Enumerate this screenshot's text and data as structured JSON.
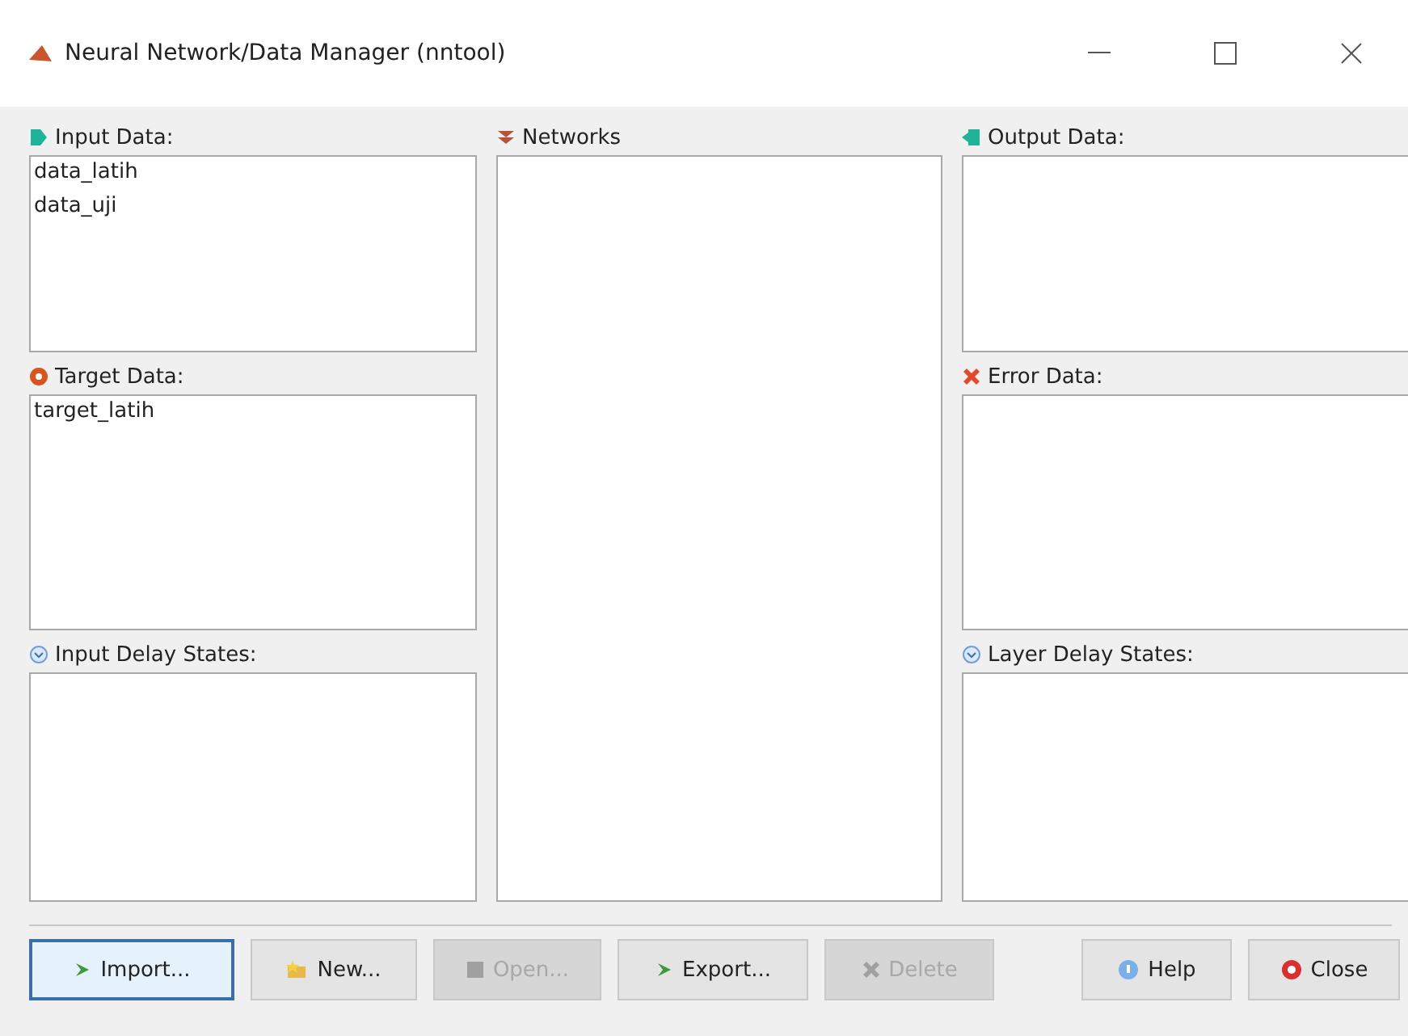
{
  "window": {
    "title": "Neural Network/Data Manager (nntool)"
  },
  "panels": [
    {
      "kind": "input",
      "label": "Input Data:",
      "items": [
        "data_latih",
        "data_uji"
      ]
    },
    {
      "kind": "network",
      "label": "Networks"
    },
    {
      "kind": "output",
      "label": "Output Data:"
    },
    {
      "kind": "target",
      "label": "Target Data:",
      "items": [
        "target_latih"
      ]
    },
    {
      "kind": "error",
      "label": "Error Data:"
    },
    {
      "kind": "delay",
      "label": "Input Delay States:"
    },
    {
      "kind": "delay",
      "label": "Layer Delay States:"
    }
  ],
  "buttons": [
    {
      "kind": "import",
      "label": "Import...",
      "disabled": false,
      "focused": true
    },
    {
      "kind": "new",
      "label": "New...",
      "disabled": false,
      "focused": false
    },
    {
      "kind": "open",
      "label": "Open...",
      "disabled": true,
      "focused": false
    },
    {
      "kind": "export",
      "label": "Export...",
      "disabled": false,
      "focused": false
    },
    {
      "kind": "delete",
      "label": "Delete",
      "disabled": true,
      "focused": false
    },
    {
      "kind": "help",
      "label": "Help",
      "disabled": false,
      "focused": false
    },
    {
      "kind": "close",
      "label": "Close",
      "disabled": false,
      "focused": false
    }
  ]
}
